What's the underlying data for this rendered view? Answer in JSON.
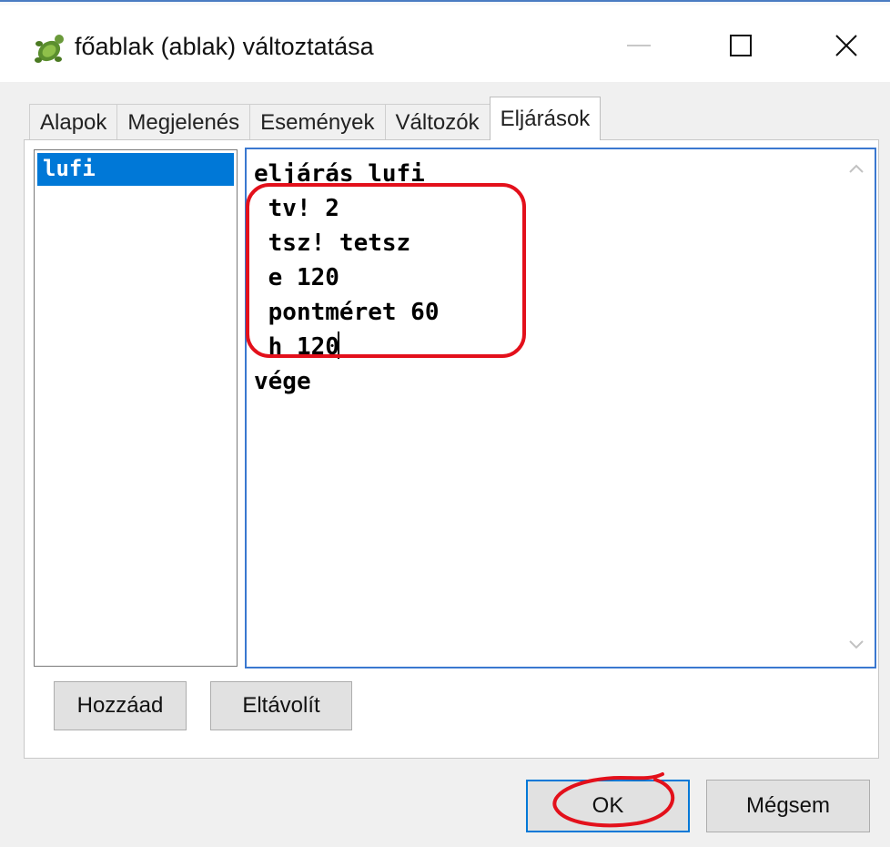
{
  "window": {
    "title": "főablak (ablak) változtatása",
    "app_icon": "turtle-logo-icon",
    "controls": {
      "minimize": "minimize-icon",
      "maximize": "maximize-icon",
      "close": "close-icon"
    }
  },
  "tabs": [
    {
      "label": "Alapok",
      "active": false
    },
    {
      "label": "Megjelenés",
      "active": false
    },
    {
      "label": "Események",
      "active": false
    },
    {
      "label": "Változók",
      "active": false
    },
    {
      "label": "Eljárások",
      "active": true
    }
  ],
  "procedures": {
    "items": [
      {
        "label": "lufi",
        "selected": true
      }
    ]
  },
  "editor": {
    "lines": [
      "eljárás lufi",
      " tv! 2",
      " tsz! tetsz",
      " e 120",
      " pontméret 60",
      " h 120",
      "vége"
    ],
    "scroll_up_icon": "chevron-up-icon",
    "scroll_down_icon": "chevron-down-icon"
  },
  "buttons": {
    "add": "Hozzáad",
    "remove": "Eltávolít",
    "ok": "OK",
    "cancel": "Mégsem"
  },
  "colors": {
    "selection": "#0078d7",
    "annotation": "#e3101b",
    "editor_border": "#3a78d0"
  }
}
